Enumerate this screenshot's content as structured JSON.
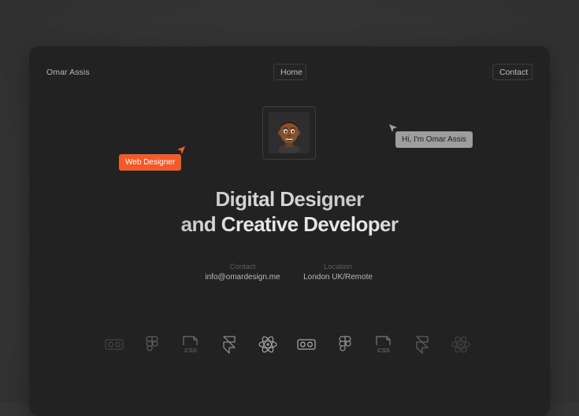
{
  "header": {
    "brand": "Omar Assis",
    "nav_home": "Home",
    "nav_contact": "Contact"
  },
  "badges": {
    "role": "Web Designer",
    "greeting": "Hi, I'm Omar Assis"
  },
  "hero": {
    "line1": "Digital Designer",
    "line2": "and Creative Developer"
  },
  "info": {
    "contact_label": "Contact",
    "contact_value": "info@omardesign.me",
    "location_label": "Location",
    "location_value": "London UK/Remote"
  },
  "tool_icons": {
    "css_text": "CSS",
    "names": [
      "vr-headset-icon",
      "figma-icon",
      "css-file-icon",
      "framer-icon",
      "react-atom-icon",
      "vr-headset-icon",
      "figma-icon",
      "css-file-icon",
      "framer-icon",
      "react-atom-icon"
    ]
  },
  "colors": {
    "accent": "#f25a2a",
    "card_bg": "#222222",
    "page_bg": "#353535"
  }
}
